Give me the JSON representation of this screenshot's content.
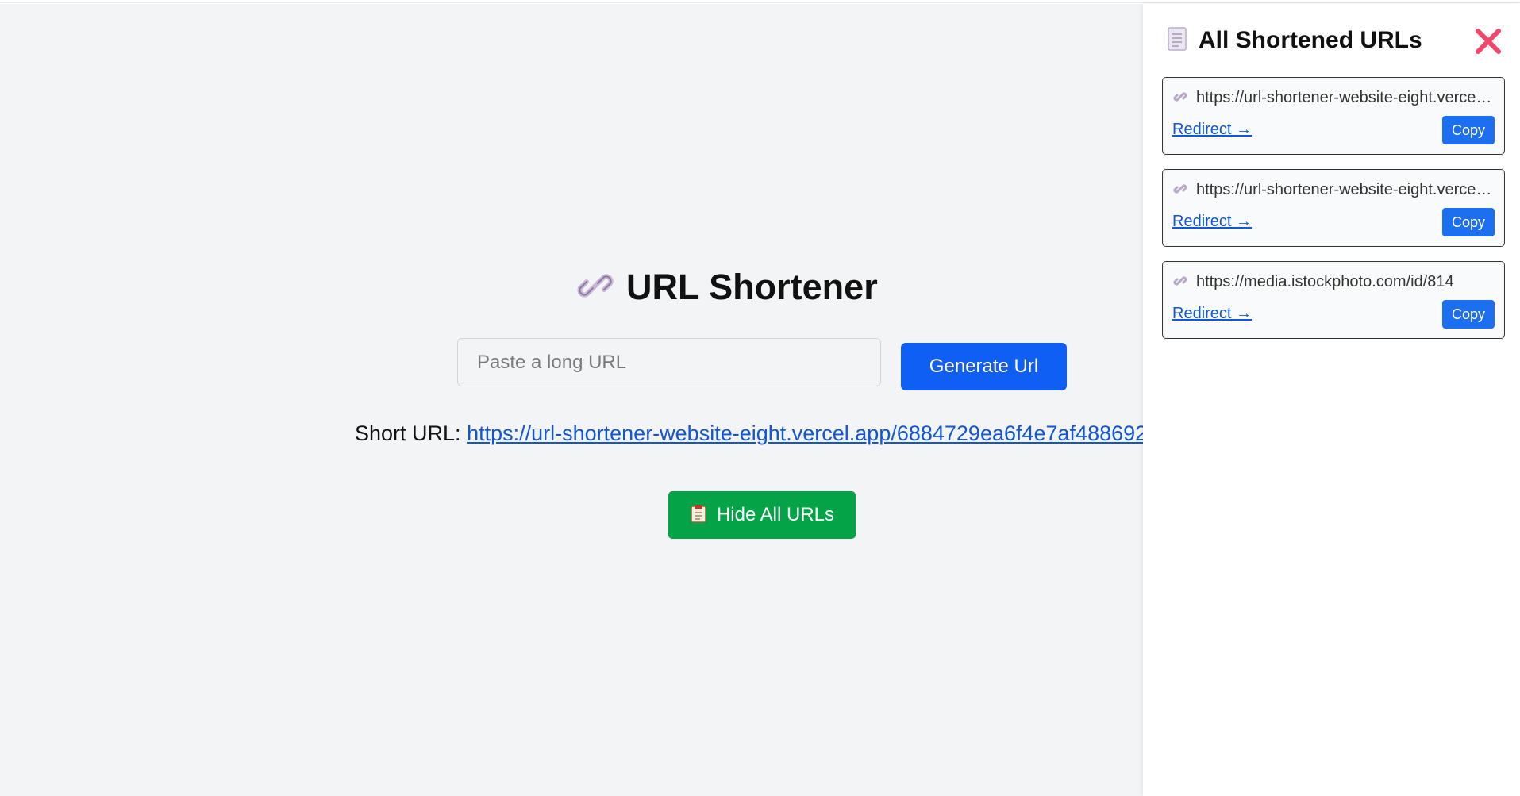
{
  "main": {
    "title": "URL Shortener",
    "input_placeholder": "Paste a long URL",
    "generate_label": "Generate Url",
    "short_url_label": "Short URL:",
    "short_url_value": "https://url-shortener-website-eight.vercel.app/6884729ea6f4e7af488692",
    "hide_label": "Hide All URLs"
  },
  "sidebar": {
    "title": "All Shortened URLs",
    "items": [
      {
        "url": "https://url-shortener-website-eight.vercel.app/",
        "redirect_label": "Redirect →",
        "copy_label": "Copy"
      },
      {
        "url": "https://url-shortener-website-eight.vercel.app/",
        "redirect_label": "Redirect →",
        "copy_label": "Copy"
      },
      {
        "url": "https://media.istockphoto.com/id/814",
        "redirect_label": "Redirect →",
        "copy_label": "Copy"
      }
    ]
  },
  "colors": {
    "primary_button": "#0f5ff5",
    "hide_button": "#05a348",
    "copy_button": "#1d6ff2",
    "link": "#1156d6",
    "close_icon": "#f0476a",
    "main_background": "#f3f4f6"
  },
  "icons": {
    "title": "link-icon",
    "hide_button": "clipboard-icon",
    "sidebar_title": "document-icon",
    "close": "close-icon",
    "card": "link-icon"
  }
}
